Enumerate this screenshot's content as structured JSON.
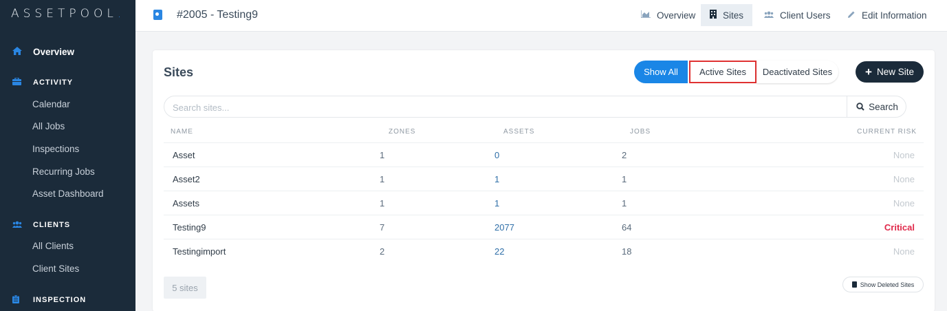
{
  "sidebar": {
    "logo_main": "ASSETPOOL",
    "logo_dot": ".",
    "overview": "Overview",
    "sections": [
      {
        "label": "ACTIVITY",
        "items": [
          "Calendar",
          "All Jobs",
          "Inspections",
          "Recurring Jobs",
          "Asset Dashboard"
        ]
      },
      {
        "label": "CLIENTS",
        "items": [
          "All Clients",
          "Client Sites"
        ]
      },
      {
        "label": "INSPECTION",
        "items": []
      }
    ]
  },
  "header": {
    "title": "#2005 - Testing9",
    "nav": [
      "Overview",
      "Sites",
      "Client Users",
      "Edit Information"
    ],
    "active_nav": "Sites"
  },
  "card": {
    "title": "Sites",
    "filters": [
      "Show All",
      "Active Sites",
      "Deactivated Sites"
    ],
    "new_site_label": "New Site",
    "search_placeholder": "Search sites...",
    "search_label": "Search",
    "columns": [
      "NAME",
      "ZONES",
      "ASSETS",
      "JOBS",
      "CURRENT RISK"
    ],
    "rows": [
      {
        "name": "Asset",
        "zones": "1",
        "assets": "0",
        "jobs": "2",
        "risk": "None"
      },
      {
        "name": "Asset2",
        "zones": "1",
        "assets": "1",
        "jobs": "1",
        "risk": "None"
      },
      {
        "name": "Assets",
        "zones": "1",
        "assets": "1",
        "jobs": "1",
        "risk": "None"
      },
      {
        "name": "Testing9",
        "zones": "7",
        "assets": "2077",
        "jobs": "64",
        "risk": "Critical"
      },
      {
        "name": "Testingimport",
        "zones": "2",
        "assets": "22",
        "jobs": "18",
        "risk": "None"
      }
    ],
    "count_label": "5 sites",
    "show_deleted_label": "Show Deleted Sites"
  },
  "colors": {
    "accent": "#1a86e6",
    "sidebar": "#1b2b3a",
    "critical": "#e0294a"
  }
}
